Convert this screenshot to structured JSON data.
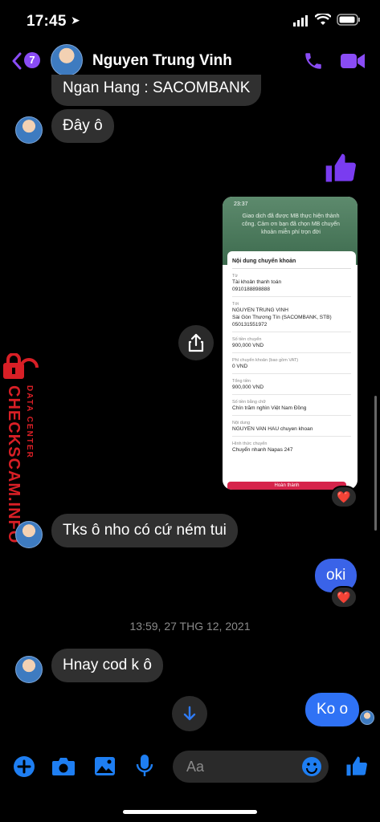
{
  "status": {
    "time": "17:45"
  },
  "header": {
    "back_badge": "7",
    "contact_name": "Nguyen Trung Vinh"
  },
  "messages": {
    "m1": "Ngan Hang : SACOMBANK",
    "m2": "Đây ô",
    "m3": "Tks ô nho có cứ ném tui",
    "m4": "oki",
    "m5": "Hnay cod k ô",
    "m6": "Ko o",
    "timestamp": "13:59, 27 THG 12, 2021"
  },
  "reactions": {
    "r1": "❤️",
    "r2": "❤️"
  },
  "receipt": {
    "time": "23:37",
    "top_message": "Giao dịch đã được MB thực hiện thành công. Cảm ơn bạn đã chọn MB chuyển khoản miễn phí trọn đời",
    "title": "Nội dung chuyển khoản",
    "from_label": "Từ",
    "from_value_1": "Tài khoản thanh toán",
    "from_value_2": "0910188898888",
    "to_label": "Tới",
    "to_value_1": "NGUYEN TRUNG VINH",
    "to_value_2": "Sài Gòn Thương Tín (SACOMBANK, STB)",
    "to_value_3": "050131551972",
    "amount_label": "Số tiền chuyển",
    "amount_value": "900,000 VND",
    "fee_label": "Phí chuyển khoản (bao gồm VAT)",
    "fee_value": "0 VND",
    "total_label": "Tổng tiền",
    "total_value": "900,000 VND",
    "words_label": "Số tiền bằng chữ",
    "words_value": "Chín trăm nghìn Việt Nam Đồng",
    "content_label": "Nội dung",
    "content_value": "NGUYEN VAN HAU chuyen khoan",
    "method_label": "Hình thức chuyển",
    "method_value": "Chuyển nhanh Napas 247",
    "button": "Hoàn thành"
  },
  "watermark": {
    "line1": "CHECKSCAM.INFO",
    "line2": "DATA CENTER"
  },
  "composer": {
    "placeholder": "Aa"
  },
  "colors": {
    "accent": "#7a3cf0",
    "blue_bubble": "#2f72f5",
    "composer_blue": "#1e7ef2",
    "watermark_red": "#d81f26"
  }
}
